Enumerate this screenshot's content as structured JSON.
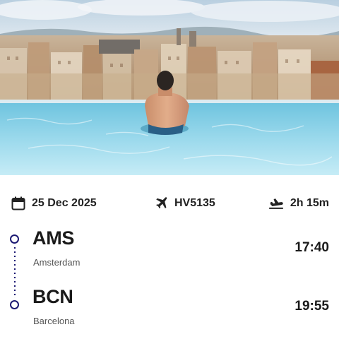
{
  "hero": {
    "image_subject": "man-in-rooftop-infinity-pool-overlooking-city"
  },
  "summary": {
    "date": "25 Dec 2025",
    "date_icon": "calendar-icon",
    "flight_number": "HV5135",
    "flight_icon": "airplane-icon",
    "duration": "2h 15m",
    "duration_icon": "plane-landing-icon"
  },
  "route": {
    "origin": {
      "code": "AMS",
      "city": "Amsterdam",
      "time": "17:40"
    },
    "destination": {
      "code": "BCN",
      "city": "Barcelona",
      "time": "19:55"
    }
  },
  "colors": {
    "timeline": "#1d1a73",
    "pool_water": "#8fd3e8",
    "text_primary": "#1a1a1a",
    "text_secondary": "#555555"
  }
}
